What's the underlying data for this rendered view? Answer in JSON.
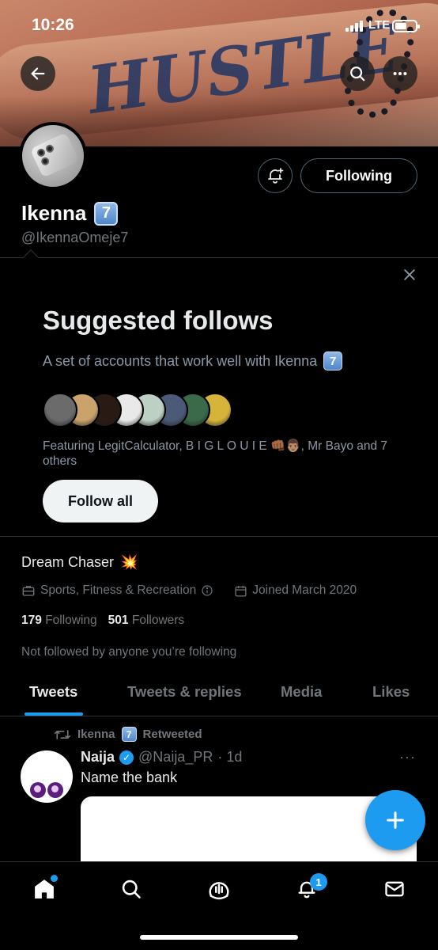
{
  "status_bar": {
    "time": "10:26",
    "network": "LTE"
  },
  "banner": {
    "tattoo_text": "HUSTLE"
  },
  "profile": {
    "name": "Ikenna",
    "name_emoji": "7",
    "handle": "@IkennaOmeje7",
    "following_button": "Following",
    "bio": "Dream Chaser",
    "bio_emoji": "💥",
    "category": "Sports, Fitness & Recreation",
    "joined": "Joined March 2020",
    "following_count": "179",
    "following_label": "Following",
    "followers_count": "501",
    "followers_label": "Followers",
    "not_followed": "Not followed by anyone you’re following"
  },
  "suggested": {
    "title": "Suggested follows",
    "description": "A set of accounts that work well with Ikenna",
    "description_emoji": "7",
    "featuring": "Featuring LegitCalculator, B I G L O U I E 👊🏾👨🏽, Mr Bayo and 7 others",
    "follow_all": "Follow all",
    "face_colors": [
      "#6b6b6b",
      "#c9a36b",
      "#2a1a14",
      "#e9e9e9",
      "#bcd0c4",
      "#4b5a78",
      "#3a6a4a",
      "#d6b43a"
    ]
  },
  "tabs": [
    {
      "label": "Tweets"
    },
    {
      "label": "Tweets & replies"
    },
    {
      "label": "Media"
    },
    {
      "label": "Likes"
    }
  ],
  "tweet": {
    "retweeted_by": "Ikenna",
    "retweeted_emoji": "7",
    "retweeted_label": "Retweeted",
    "author_name": "Naija",
    "author_handle": "@Naija_PR",
    "time": "· 1d",
    "more": "···",
    "text": "Name the bank"
  },
  "nav": {
    "notifications_badge": "1"
  },
  "colors": {
    "accent": "#1d9bf0",
    "background": "#000000",
    "muted": "#71767b"
  }
}
